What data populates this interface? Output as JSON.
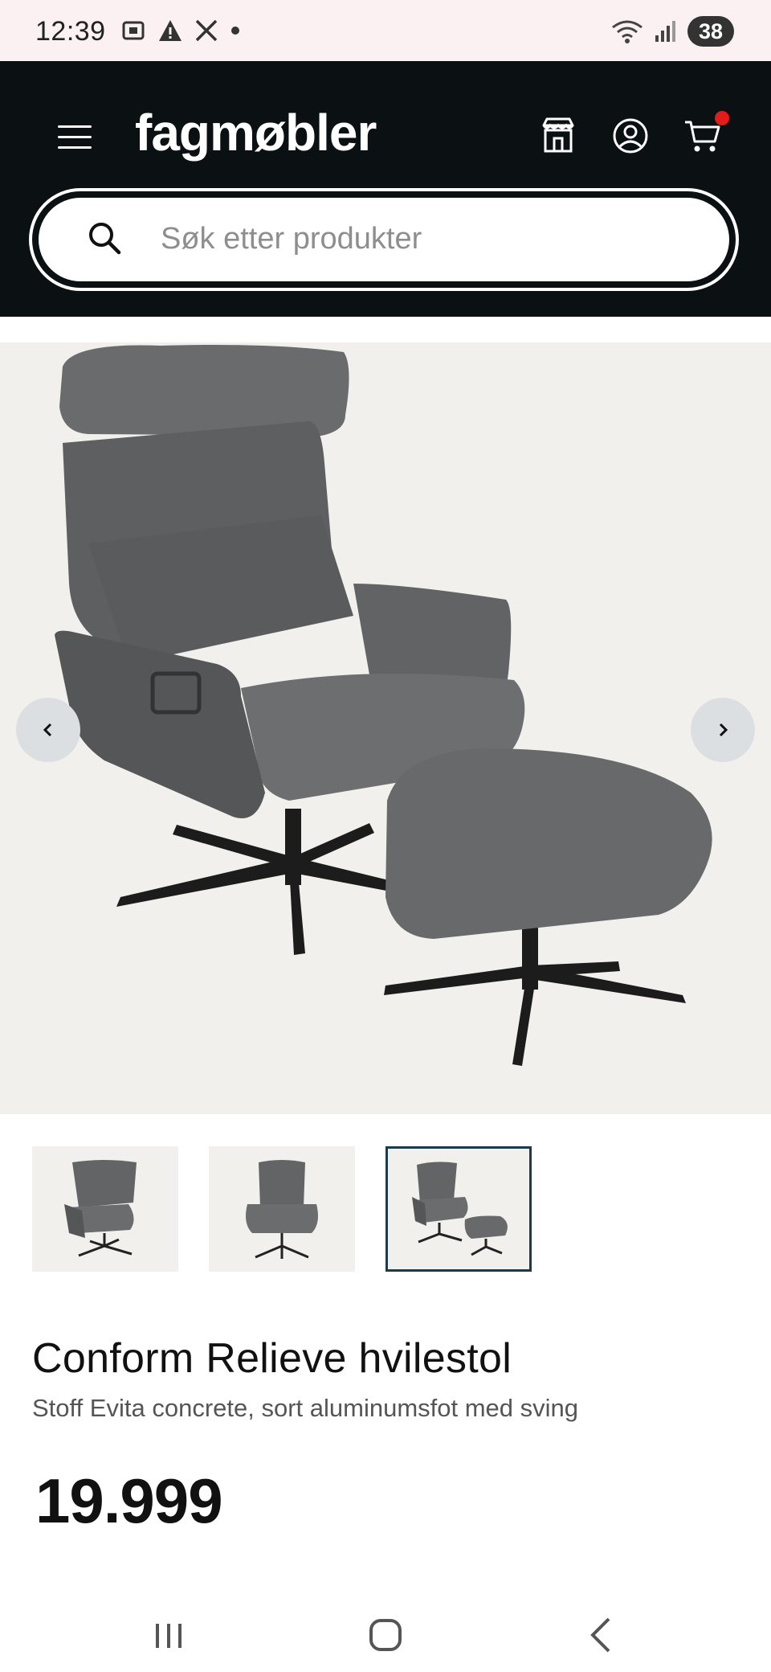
{
  "status_bar": {
    "time": "12:39",
    "left_icons": [
      "screenshot-icon",
      "warning-icon",
      "x-icon",
      "dot-icon"
    ],
    "right_icons": [
      "wifi-icon",
      "signal-icon"
    ],
    "battery": "38"
  },
  "header": {
    "logo": "fagmøbler",
    "icons": [
      "menu-icon",
      "store-icon",
      "account-icon",
      "cart-icon"
    ],
    "cart_badge_color": "#e21b1b",
    "background": "#0b1013"
  },
  "search": {
    "placeholder": "Søk etter produkter",
    "value": ""
  },
  "product": {
    "title": "Conform Relieve hvilestol",
    "subtitle": "Stoff Evita concrete, sort aluminumsfot med sving",
    "price": "19.999",
    "selected_thumbnail": 3,
    "thumbnails": [
      "Hvilestol side view",
      "Hvilestol front view",
      "Hvilestol with footstool"
    ]
  },
  "nav": {
    "buttons": [
      "recent-apps-icon",
      "home-icon",
      "back-icon"
    ]
  }
}
